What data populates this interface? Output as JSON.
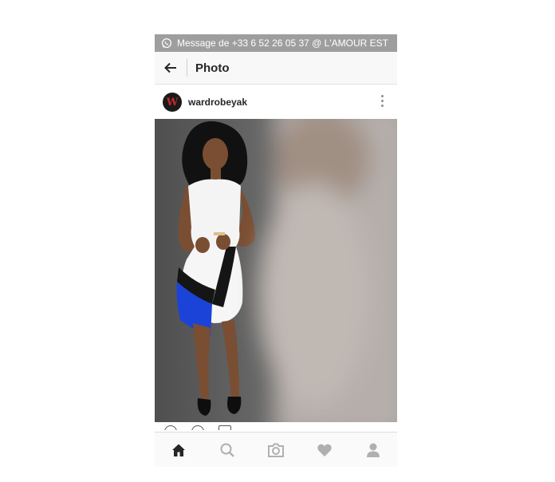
{
  "status_notification": {
    "icon": "whatsapp-icon",
    "text": "Message de +33 6 52 26 05 37 @ L'AMOUR EST"
  },
  "app_bar": {
    "back_icon": "arrow-left-icon",
    "title": "Photo"
  },
  "post": {
    "avatar_letter": "W",
    "username": "wardrobeyak",
    "more_icon": "more-vertical-icon",
    "image": "fashion-photo"
  },
  "actions": [
    "heart-icon",
    "comment-icon",
    "share-icon"
  ],
  "bottom_nav": [
    "home-icon",
    "search-icon",
    "camera-icon",
    "heart-icon",
    "profile-icon"
  ],
  "colors": {
    "notification_bar": "#9e9e9e",
    "app_bar": "#f8f8f8",
    "active_nav": "#262626",
    "inactive_nav": "#b0b0b0"
  }
}
